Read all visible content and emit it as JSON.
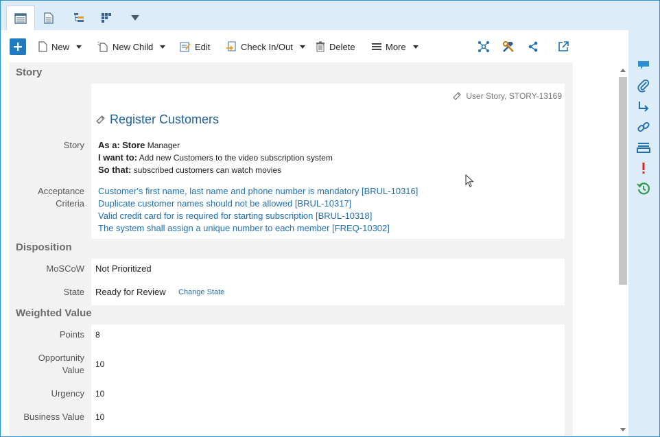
{
  "toolbar": {
    "new_label": "New",
    "new_child_label": "New Child",
    "edit_label": "Edit",
    "checkin_label": "Check In/Out",
    "delete_label": "Delete",
    "more_label": "More"
  },
  "story_section": {
    "heading": "Story",
    "type_line": "User Story, STORY-13169",
    "title": "Register Customers",
    "story_label": "Story",
    "as_a_key": "As a:",
    "as_a_value_bold": "Store",
    "as_a_value": " Manager",
    "i_want_key": "I want to:",
    "i_want_value": " Add new Customers to the video subscription system",
    "so_that_key": "So that:",
    "so_that_value": " subscribed customers can watch movies",
    "acceptance_label_1": "Acceptance",
    "acceptance_label_2": "Criteria",
    "acceptance_criteria": [
      "Customer's first name, last name and phone number is mandatory [BRUL-10316]",
      "Duplicate customer names should not be allowed [BRUL-10317]",
      "Valid credit card for is required for starting subscription [BRUL-10318]",
      "The system shall assign a unique number to each member [FREQ-10302]"
    ]
  },
  "disposition": {
    "heading": "Disposition",
    "moscow_label": "MoSCoW",
    "moscow_value": "Not Prioritized",
    "state_label": "State",
    "state_value": "Ready for Review",
    "change_state_link": "Change State"
  },
  "weighted_value": {
    "heading": "Weighted Value",
    "points_label": "Points",
    "points_value": "8",
    "opportunity_label_1": "Opportunity",
    "opportunity_label_2": "Value",
    "opportunity_value": "10",
    "urgency_label": "Urgency",
    "urgency_value": "10",
    "business_label": "Business Value",
    "business_value": "10"
  },
  "colors": {
    "accent": "#1f7ac0",
    "link": "#1f6fb2",
    "rail_bg": "#dcecf8",
    "alert": "#e02020",
    "history": "#2e9a4a"
  },
  "icons": {
    "tabs": [
      "form-view-icon",
      "document-icon",
      "tree-icon",
      "board-icon",
      "dropdown-icon"
    ],
    "toolbar_right": [
      "relationship-graph-icon",
      "tools-icon",
      "share-icon",
      "open-external-icon"
    ],
    "rail": [
      "comments-icon",
      "attachment-icon",
      "trace-icon",
      "link-icon",
      "inbox-icon",
      "alert-icon",
      "history-icon"
    ]
  }
}
